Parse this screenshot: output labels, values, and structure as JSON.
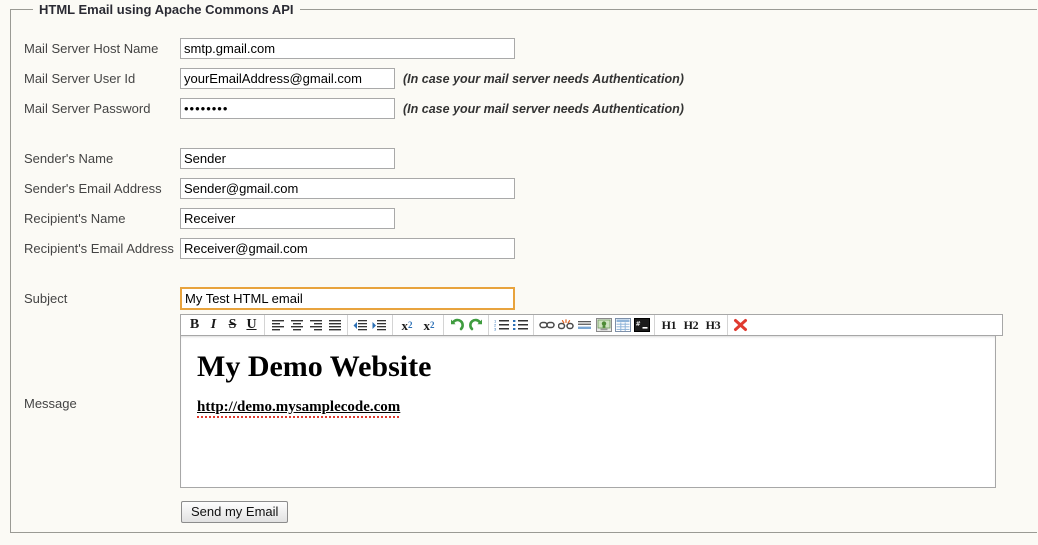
{
  "form": {
    "legend": "HTML Email using Apache Commons API",
    "auth_hint": "(In case your mail server needs Authentication)",
    "fields": {
      "host": {
        "label": "Mail Server Host Name",
        "value": "smtp.gmail.com"
      },
      "userid": {
        "label": "Mail Server User Id",
        "value": "yourEmailAddress@gmail.com"
      },
      "password": {
        "label": "Mail Server Password",
        "value": "••••••••"
      },
      "sender_name": {
        "label": "Sender's Name",
        "value": "Sender"
      },
      "sender_email": {
        "label": "Sender's Email Address",
        "value": "Sender@gmail.com"
      },
      "recipient_name": {
        "label": "Recipient's Name",
        "value": "Receiver"
      },
      "recipient_email": {
        "label": "Recipient's Email Address",
        "value": "Receiver@gmail.com"
      },
      "subject": {
        "label": "Subject",
        "value": "My Test HTML email"
      },
      "message": {
        "label": "Message"
      }
    },
    "submit_label": "Send my Email"
  },
  "editor": {
    "toolbar": {
      "groups": [
        {
          "name": "text-style",
          "buttons": [
            {
              "name": "bold-icon",
              "glyph": "B"
            },
            {
              "name": "italic-icon",
              "glyph": "I"
            },
            {
              "name": "strikethrough-icon",
              "glyph": "S"
            },
            {
              "name": "underline-icon",
              "glyph": "U"
            }
          ]
        },
        {
          "name": "alignment",
          "buttons": [
            {
              "name": "align-left-icon",
              "glyph": "align-left"
            },
            {
              "name": "align-center-icon",
              "glyph": "align-center"
            },
            {
              "name": "align-right-icon",
              "glyph": "align-right"
            },
            {
              "name": "align-justify-icon",
              "glyph": "align-justify"
            }
          ]
        },
        {
          "name": "indentation",
          "buttons": [
            {
              "name": "outdent-icon",
              "glyph": "outdent"
            },
            {
              "name": "indent-icon",
              "glyph": "indent"
            }
          ]
        },
        {
          "name": "script",
          "buttons": [
            {
              "name": "subscript-icon",
              "glyph": "x",
              "script": "2"
            },
            {
              "name": "superscript-icon",
              "glyph": "x",
              "script": "2"
            }
          ]
        },
        {
          "name": "history",
          "buttons": [
            {
              "name": "undo-icon",
              "glyph": "undo"
            },
            {
              "name": "redo-icon",
              "glyph": "redo"
            }
          ]
        },
        {
          "name": "lists",
          "buttons": [
            {
              "name": "ordered-list-icon",
              "glyph": "ordered-list"
            },
            {
              "name": "unordered-list-icon",
              "glyph": "unordered-list"
            }
          ]
        },
        {
          "name": "insert",
          "buttons": [
            {
              "name": "link-icon",
              "glyph": "link"
            },
            {
              "name": "unlink-icon",
              "glyph": "unlink"
            },
            {
              "name": "horizontal-rule-icon",
              "glyph": "hrule"
            },
            {
              "name": "insert-image-icon",
              "glyph": "image"
            },
            {
              "name": "insert-table-icon",
              "glyph": "table"
            },
            {
              "name": "source-code-icon",
              "glyph": "source"
            }
          ]
        },
        {
          "name": "headings",
          "buttons": [
            {
              "name": "heading-1-button",
              "glyph": "H1"
            },
            {
              "name": "heading-2-button",
              "glyph": "H2"
            },
            {
              "name": "heading-3-button",
              "glyph": "H3"
            }
          ]
        },
        {
          "name": "remove",
          "buttons": [
            {
              "name": "remove-format-icon",
              "glyph": "remove"
            }
          ]
        }
      ]
    },
    "content": {
      "heading": "My Demo Website",
      "link_text": "http://demo.mysamplecode.com"
    }
  },
  "colors": {
    "page_background": "#fbfaf5",
    "focus_border": "#e8a33d",
    "field_border": "#a9a9a9",
    "undo_green": "#3f9c3f",
    "remove_red": "#e03a2f",
    "link_blue": "#2b6fb5"
  }
}
